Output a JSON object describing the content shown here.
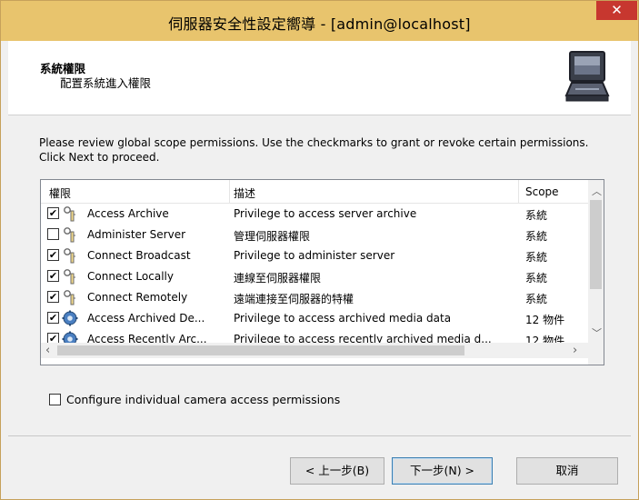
{
  "window": {
    "title": "伺服器安全性設定嚮導 - [admin@localhost]",
    "close_glyph": "✕"
  },
  "header": {
    "title": "系統權限",
    "subtitle": "配置系統進入權限",
    "icon": "server-terminal-icon"
  },
  "instructions": "Please review global scope permissions. Use the checkmarks to grant or revoke certain permissions. Click Next to proceed.",
  "table": {
    "columns": [
      "權限",
      "描述",
      "Scope"
    ],
    "rows": [
      {
        "checked": true,
        "icon": "key-icon",
        "name": "Access Archive",
        "description": "Privilege to access server archive",
        "scope": "系統"
      },
      {
        "checked": false,
        "icon": "key-icon",
        "name": "Administer Server",
        "description": "管理伺服器權限",
        "scope": "系統"
      },
      {
        "checked": true,
        "icon": "key-icon",
        "name": "Connect Broadcast",
        "description": "Privilege to administer server",
        "scope": "系統"
      },
      {
        "checked": true,
        "icon": "key-icon",
        "name": "Connect Locally",
        "description": "連線至伺服器權限",
        "scope": "系統"
      },
      {
        "checked": true,
        "icon": "key-icon",
        "name": "Connect Remotely",
        "description": "遠端連接至伺服器的特權",
        "scope": "系統"
      },
      {
        "checked": true,
        "icon": "gear-icon",
        "name": "Access Archived De...",
        "description": "Privilege to access archived media data",
        "scope": "12 物件"
      },
      {
        "checked": true,
        "icon": "gear-icon",
        "name": "Access Recently Arc...",
        "description": "Privilege to access recently archived media d...",
        "scope": "12 物件"
      }
    ]
  },
  "camera_option": {
    "checked": false,
    "label": "Configure individual camera access permissions"
  },
  "buttons": {
    "back": "< 上一步(B)",
    "next": "下一步(N) >",
    "cancel": "取消"
  },
  "colors": {
    "titlebar": "#e8c46d",
    "close": "#c7372f",
    "border": "#c6a15b"
  }
}
